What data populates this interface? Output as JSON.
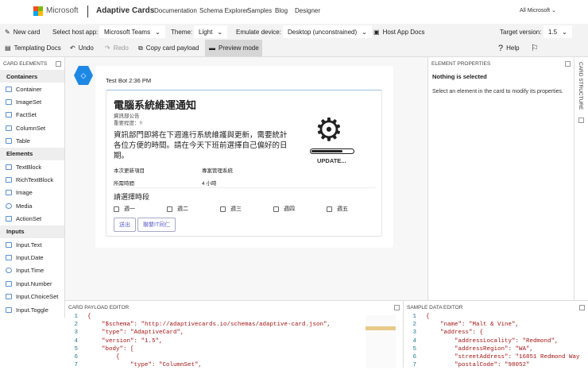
{
  "header": {
    "brand": "Microsoft",
    "product": "Adaptive Cards",
    "nav": [
      "Documentation",
      "Schema Explorer",
      "Samples",
      "Blog",
      "Designer"
    ],
    "all_microsoft": "All Microsoft ⌄"
  },
  "toolbar": {
    "new_card": "New card",
    "host_app_label": "Select host app:",
    "host_app": "Microsoft Teams",
    "theme_label": "Theme:",
    "theme": "Light",
    "device_label": "Emulate device:",
    "device": "Desktop (unconstrained)",
    "host_docs": "Host App Docs",
    "target_label": "Target version:",
    "target": "1.5",
    "templating_docs": "Templating Docs",
    "undo": "Undo",
    "redo": "Redo",
    "copy_payload": "Copy card payload",
    "preview_mode": "Preview mode",
    "help": "Help"
  },
  "sidebar": {
    "title": "CARD ELEMENTS",
    "groups": [
      {
        "label": "Containers",
        "items": [
          "Container",
          "ImageSet",
          "FactSet",
          "ColumnSet",
          "Table"
        ]
      },
      {
        "label": "Elements",
        "items": [
          "TextBlock",
          "RichTextBlock",
          "Image",
          "Media",
          "ActionSet"
        ]
      },
      {
        "label": "Inputs",
        "items": [
          "Input.Text",
          "Input.Date",
          "Input.Time",
          "Input.Number",
          "Input.ChoiceSet",
          "Input.Toggle"
        ]
      }
    ]
  },
  "card": {
    "sender": "Test Bot 2:36 PM",
    "title": "電腦系統維運通知",
    "subtitle": "資訊部公告",
    "importance": "重要程度：!!",
    "body": "資訊部門即將在下週進行系統維護與更新，需要統計各位方便的時間。請在今天下班前選擇自己偏好的日期。",
    "image_caption": "UPDATE...",
    "facts": [
      {
        "k": "本次更新項目",
        "v": "專案管理系統"
      },
      {
        "k": "所需時間",
        "v": "4 小時"
      }
    ],
    "choose": "請選擇時段",
    "choices": [
      "週一",
      "週二",
      "週三",
      "週四",
      "週五"
    ],
    "actions": [
      "送出",
      "聯繫IT同仁"
    ]
  },
  "properties": {
    "title": "ELEMENT PROPERTIES",
    "heading": "Nothing is selected",
    "hint": "Select an element in the card to modify its properties."
  },
  "structure": {
    "title": "CARD STRUCTURE"
  },
  "payload_editor": {
    "title": "CARD PAYLOAD EDITOR",
    "lines": [
      [
        "1",
        "{"
      ],
      [
        "2",
        "    \"$schema\": \"http://adaptivecards.io/schemas/adaptive-card.json\","
      ],
      [
        "3",
        "    \"type\": \"AdaptiveCard\","
      ],
      [
        "4",
        "    \"version\": \"1.5\","
      ],
      [
        "5",
        "    \"body\": ["
      ],
      [
        "6",
        "        {"
      ],
      [
        "7",
        "            \"type\": \"ColumnSet\","
      ]
    ]
  },
  "sample_editor": {
    "title": "SAMPLE DATA EDITOR",
    "lines": [
      [
        "1",
        "{"
      ],
      [
        "2",
        "    \"name\": \"Malt & Vine\","
      ],
      [
        "3",
        "    \"address\": {"
      ],
      [
        "4",
        "        \"addressLocality\": \"Redmond\","
      ],
      [
        "5",
        "        \"addressRegion\": \"WA\","
      ],
      [
        "6",
        "        \"streetAddress\": \"16851 Redmond Way"
      ],
      [
        "7",
        "        \"postalCode\": \"98052\""
      ]
    ]
  },
  "colors": {
    "accent": "#5b5fc7",
    "bot": "#1e88e5",
    "preview_active": "#d6d6d6"
  }
}
